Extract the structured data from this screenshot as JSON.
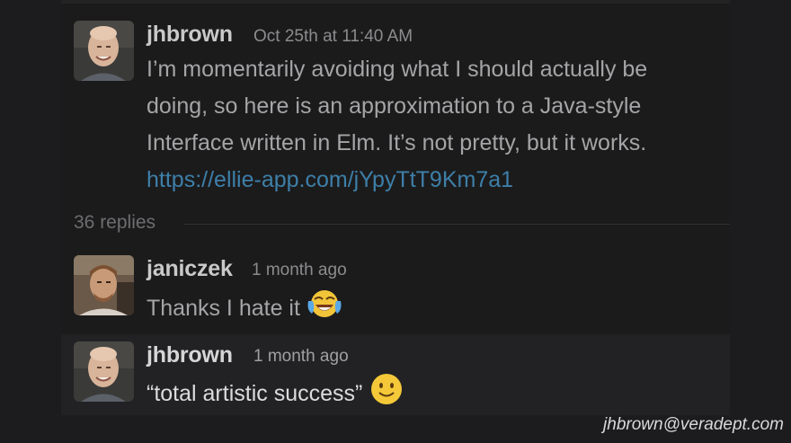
{
  "thread": {
    "parent": {
      "author": "jhbrown",
      "timestamp": "Oct 25th at 11:40 AM",
      "lines": [
        "I’m momentarily avoiding what I should actually be",
        "doing, so here is an approximation to a Java-style",
        "Interface written in Elm.  It’s not pretty, but it works."
      ],
      "link": "https://ellie-app.com/jYpyTtT9Km7a1"
    },
    "reply_count": "36 replies",
    "replies": [
      {
        "author": "janiczek",
        "timestamp": "1 month ago",
        "text": "Thanks I hate it",
        "emoji": "tears-of-joy-emoji"
      },
      {
        "author": "jhbrown",
        "timestamp": "1 month ago",
        "text": "“total artistic success”",
        "emoji": "slightly-smiling-emoji"
      }
    ]
  },
  "watermark": "jhbrown@veradept.com",
  "colors": {
    "background": "#1c1c1e",
    "username": "#c9c9ca",
    "message_text": "#a5a5a7",
    "timestamp": "#8c8c8e",
    "link": "#3e7fa8",
    "highlight_row": "#222224"
  }
}
